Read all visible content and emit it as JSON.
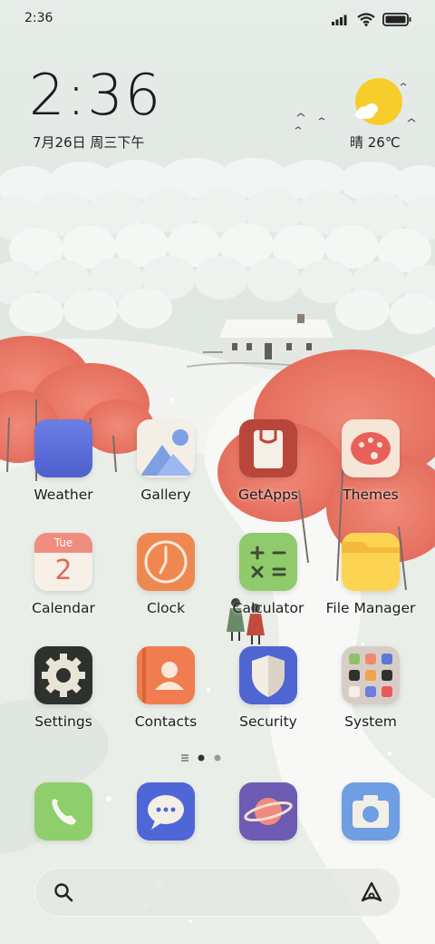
{
  "status_bar": {
    "time": "2:36",
    "icons": [
      "signal-icon",
      "wifi-icon",
      "battery-icon"
    ]
  },
  "clock_widget": {
    "time": "2:36",
    "date": "7月26日 周三下午"
  },
  "weather_widget": {
    "text": "晴 26℃",
    "icon": "sun-cloud-icon"
  },
  "apps": [
    {
      "label": "Weather",
      "icon": "weather-icon"
    },
    {
      "label": "Gallery",
      "icon": "gallery-icon"
    },
    {
      "label": "GetApps",
      "icon": "getapps-icon"
    },
    {
      "label": "Themes",
      "icon": "palette-icon"
    },
    {
      "label": "Calendar",
      "icon": "calendar-icon",
      "badge": "Tue",
      "day": "2"
    },
    {
      "label": "Clock",
      "icon": "clock-icon"
    },
    {
      "label": "Calculator",
      "icon": "calculator-icon"
    },
    {
      "label": "File Manager",
      "icon": "folder-icon"
    },
    {
      "label": "Settings",
      "icon": "gear-icon"
    },
    {
      "label": "Contacts",
      "icon": "contacts-icon"
    },
    {
      "label": "Security",
      "icon": "shield-icon"
    },
    {
      "label": "System",
      "icon": "folder-icon"
    }
  ],
  "page_indicator": {
    "pages": 2,
    "current": 1
  },
  "dock": [
    {
      "icon": "phone-icon"
    },
    {
      "icon": "messages-icon"
    },
    {
      "icon": "browser-icon"
    },
    {
      "icon": "camera-icon"
    }
  ],
  "search_bar": {
    "icons": [
      "search-icon",
      "assistant-icon"
    ]
  },
  "colors": {
    "background": "#e4ebe6",
    "tree_red": "#ee7a6a",
    "text": "#1d1d1d"
  }
}
